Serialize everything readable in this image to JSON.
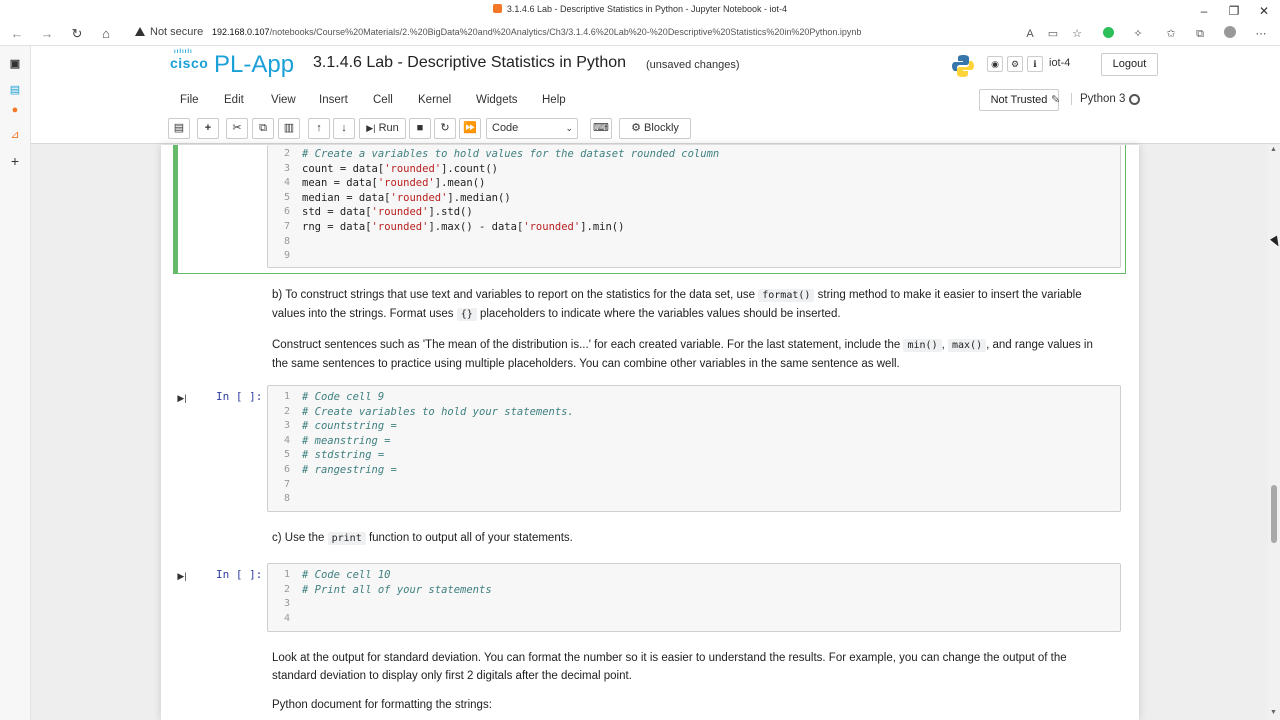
{
  "browser": {
    "tab_title": "3.1.4.6 Lab - Descriptive Statistics in Python - Jupyter Notebook - iot-4",
    "security_label": "Not secure",
    "url_host": "192.168.0.107",
    "url_path": "/notebooks/Course%20Materials/2.%20BigData%20and%20Analytics/Ch3/3.1.4.6%20Lab%20-%20Descriptive%20Statistics%20in%20Python.ipynb"
  },
  "header": {
    "brand_cisco": "cisco",
    "brand_app": "PL-App",
    "notebook_title": "3.1.4.6 Lab - Descriptive Statistics in Python",
    "save_status": "(unsaved changes)",
    "user": "iot-4",
    "logout_label": "Logout"
  },
  "menu": [
    "File",
    "Edit",
    "View",
    "Insert",
    "Cell",
    "Kernel",
    "Widgets",
    "Help"
  ],
  "kernel": {
    "trust_label": "Not Trusted",
    "name": "Python 3"
  },
  "toolbar": {
    "run_label": "Run",
    "cell_type": "Code",
    "blockly_label": "Blockly"
  },
  "cells": {
    "cell8": {
      "lines": [
        {
          "n": "2",
          "text": "# Create a variables to hold values for the dataset rounded column"
        },
        {
          "n": "3",
          "text": "count = data['rounded'].count()"
        },
        {
          "n": "4",
          "text": "mean = data['rounded'].mean()"
        },
        {
          "n": "5",
          "text": "median = data['rounded'].median()"
        },
        {
          "n": "6",
          "text": "std = data['rounded'].std()"
        },
        {
          "n": "7",
          "text": "rng = data['rounded'].max() - data['rounded'].min()"
        },
        {
          "n": "8",
          "text": ""
        },
        {
          "n": "9",
          "text": ""
        }
      ]
    },
    "md_b": {
      "p1_a": "b) To construct strings that use text and variables to report on the statistics for the data set, use",
      "p1_code1": "format()",
      "p1_b": "string method to make it easier to insert the variable values into the strings. Format uses",
      "p1_code2": "{}",
      "p1_c": "placeholders to indicate where the variables values should be inserted.",
      "p2_a": "Construct sentences such as 'The mean of the distribution is...' for each created variable. For the last statement, include the",
      "p2_code1": "min()",
      "p2_sep": ",",
      "p2_code2": "max()",
      "p2_b": ", and range values in the same sentences to practice using multiple placeholders. You can combine other variables in the same sentence as well."
    },
    "cell9": {
      "prompt": "In [ ]:",
      "lines": [
        {
          "n": "1",
          "text": "# Code cell 9"
        },
        {
          "n": "2",
          "text": "# Create variables to hold your statements."
        },
        {
          "n": "3",
          "text": "# countstring ="
        },
        {
          "n": "4",
          "text": "# meanstring ="
        },
        {
          "n": "5",
          "text": "# stdstring ="
        },
        {
          "n": "6",
          "text": "# rangestring ="
        },
        {
          "n": "7",
          "text": ""
        },
        {
          "n": "8",
          "text": ""
        }
      ]
    },
    "md_c": {
      "a": "c) Use the",
      "code": "print",
      "b": "function to output all of your statements."
    },
    "cell10": {
      "prompt": "In [ ]:",
      "lines": [
        {
          "n": "1",
          "text": "# Code cell 10"
        },
        {
          "n": "2",
          "text": "# Print all of your statements"
        },
        {
          "n": "3",
          "text": ""
        },
        {
          "n": "4",
          "text": ""
        }
      ]
    },
    "md_d": {
      "p1": "Look at the output for standard deviation. You can format the number so it is easier to understand the results. For example, you can change the output of the standard deviation to display only first 2 digitals after the decimal point.",
      "p2": "Python document for formatting the strings:"
    }
  }
}
